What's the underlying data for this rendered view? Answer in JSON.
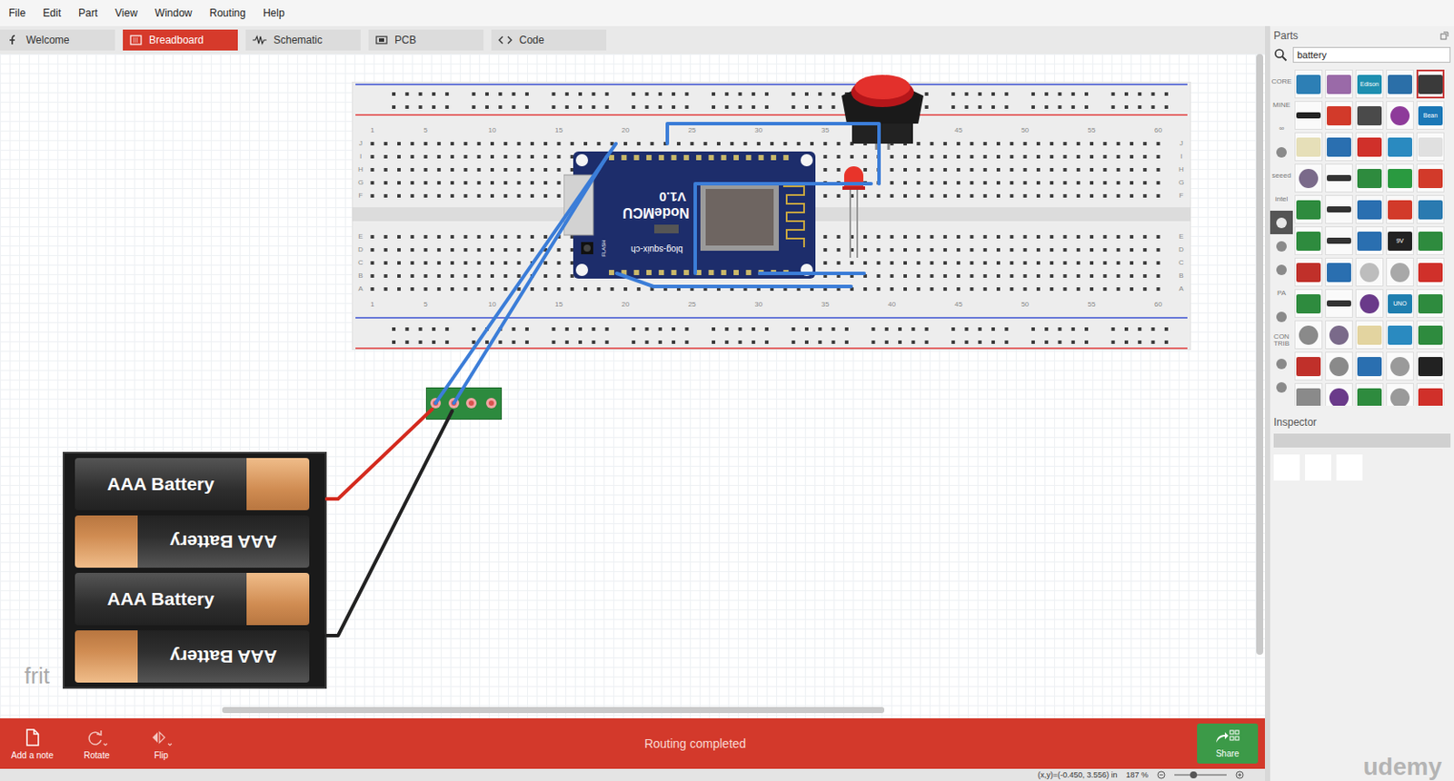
{
  "menu": [
    "File",
    "Edit",
    "Part",
    "View",
    "Window",
    "Routing",
    "Help"
  ],
  "tabs": [
    {
      "label": "Welcome",
      "selected": false
    },
    {
      "label": "Breadboard",
      "selected": true
    },
    {
      "label": "Schematic",
      "selected": false
    },
    {
      "label": "PCB",
      "selected": false
    },
    {
      "label": "Code",
      "selected": false
    }
  ],
  "canvas": {
    "watermark": "frit",
    "breadboard": {
      "columns": [
        "1",
        "5",
        "10",
        "15",
        "20",
        "25",
        "30",
        "35",
        "40",
        "45",
        "50",
        "55",
        "60"
      ],
      "rows_top": [
        "J",
        "I",
        "H",
        "G",
        "F"
      ],
      "rows_bottom": [
        "E",
        "D",
        "C",
        "B",
        "A"
      ]
    },
    "board": {
      "name": "NodeMCU",
      "version": "V1.0",
      "url": "blog-squix-ch",
      "button": "FLASH"
    },
    "batteries": [
      {
        "label": "AAA Battery",
        "flipped": false
      },
      {
        "label": "AAA Battery",
        "flipped": true
      },
      {
        "label": "AAA Battery",
        "flipped": false
      },
      {
        "label": "AAA Battery",
        "flipped": true
      }
    ],
    "wires": [
      {
        "color": "#3b7dd8"
      },
      {
        "color": "#3b7dd8"
      },
      {
        "color": "#3b7dd8"
      },
      {
        "color": "#3b7dd8"
      },
      {
        "color": "#3b7dd8"
      },
      {
        "color": "#3b7dd8"
      },
      {
        "color": "#d42a1e"
      },
      {
        "color": "#222222"
      }
    ]
  },
  "toolbar": {
    "buttons": [
      "Add a note",
      "Rotate",
      "Flip"
    ],
    "status": "Routing completed",
    "share": "Share"
  },
  "status_bar": {
    "coords": "(x,y)=(-0.450, 3.556) in",
    "zoom": "187 %"
  },
  "parts": {
    "title": "Parts",
    "search": "battery",
    "categories": [
      {
        "kind": "text",
        "label": "CORE",
        "selected": false
      },
      {
        "kind": "text",
        "label": "MINE",
        "selected": false
      },
      {
        "kind": "text",
        "label": "∞",
        "selected": false
      },
      {
        "kind": "icon",
        "selected": false
      },
      {
        "kind": "text",
        "label": "seeed",
        "selected": false
      },
      {
        "kind": "text",
        "label": "intel",
        "selected": false
      },
      {
        "kind": "icon",
        "selected": true
      },
      {
        "kind": "icon",
        "selected": false
      },
      {
        "kind": "icon",
        "selected": false
      },
      {
        "kind": "text",
        "label": "PA",
        "selected": false
      },
      {
        "kind": "icon",
        "selected": false
      },
      {
        "kind": "text",
        "label": "CON TRIB",
        "selected": false
      },
      {
        "kind": "icon",
        "selected": false
      },
      {
        "kind": "icon",
        "selected": false
      }
    ],
    "items": [
      {
        "kind": "board",
        "color": "#2d7fb5",
        "selected": false
      },
      {
        "kind": "board",
        "color": "#9a6aa8",
        "selected": false
      },
      {
        "kind": "board",
        "color": "#1e8fb0",
        "label": "Edison",
        "selected": false
      },
      {
        "kind": "board",
        "color": "#2b6fa8",
        "selected": false
      },
      {
        "kind": "board",
        "color": "#3a3a3a",
        "selected": true
      },
      {
        "kind": "bar",
        "color": "#222222",
        "selected": false
      },
      {
        "kind": "board",
        "color": "#d23a2a",
        "selected": false
      },
      {
        "kind": "board",
        "color": "#4a4a4a",
        "selected": false
      },
      {
        "kind": "round",
        "color": "#8e3b9a",
        "selected": false
      },
      {
        "kind": "board",
        "color": "#1b78b7",
        "label": "Bean",
        "selected": false
      },
      {
        "kind": "board",
        "color": "#e6dfb8",
        "selected": false
      },
      {
        "kind": "board",
        "color": "#2a6fb0",
        "selected": false
      },
      {
        "kind": "board",
        "color": "#d0302a",
        "selected": false
      },
      {
        "kind": "board",
        "color": "#2a8ac0",
        "selected": false
      },
      {
        "kind": "board",
        "color": "#e0e0e0",
        "selected": false
      },
      {
        "kind": "round",
        "color": "#7a6a8a",
        "selected": false
      },
      {
        "kind": "bar",
        "color": "#333333",
        "selected": false
      },
      {
        "kind": "board",
        "color": "#2e8b3e",
        "selected": false
      },
      {
        "kind": "board",
        "color": "#2a9a40",
        "selected": false
      },
      {
        "kind": "board",
        "color": "#d23a2a",
        "selected": false
      },
      {
        "kind": "board",
        "color": "#2e8b3e",
        "selected": false
      },
      {
        "kind": "bar",
        "color": "#333333",
        "selected": false
      },
      {
        "kind": "board",
        "color": "#2a6fb0",
        "selected": false
      },
      {
        "kind": "board",
        "color": "#d23a2a",
        "selected": false
      },
      {
        "kind": "board",
        "color": "#2a7ab0",
        "selected": false
      },
      {
        "kind": "board",
        "color": "#2e8b3e",
        "selected": false
      },
      {
        "kind": "bar",
        "color": "#333333",
        "selected": false
      },
      {
        "kind": "board",
        "color": "#2a6fb0",
        "selected": false
      },
      {
        "kind": "board",
        "color": "#222222",
        "label": "9V",
        "selected": false
      },
      {
        "kind": "board",
        "color": "#2e8b3e",
        "selected": false
      },
      {
        "kind": "board",
        "color": "#c0302a",
        "selected": false
      },
      {
        "kind": "board",
        "color": "#2a6fb0",
        "selected": false
      },
      {
        "kind": "round",
        "color": "#bdbdbd",
        "selected": false
      },
      {
        "kind": "round",
        "color": "#a8a8a8",
        "selected": false
      },
      {
        "kind": "board",
        "color": "#d0302a",
        "selected": false
      },
      {
        "kind": "board",
        "color": "#2e8b3e",
        "selected": false
      },
      {
        "kind": "bar",
        "color": "#333333",
        "selected": false
      },
      {
        "kind": "round",
        "color": "#6a3a8a",
        "selected": false
      },
      {
        "kind": "board",
        "color": "#1f7fb0",
        "label": "UNO",
        "selected": false
      },
      {
        "kind": "board",
        "color": "#2e8b3e",
        "selected": false
      },
      {
        "kind": "round",
        "color": "#8a8a8a",
        "selected": false
      },
      {
        "kind": "round",
        "color": "#7a6a8a",
        "selected": false
      },
      {
        "kind": "board",
        "color": "#e3d4a0",
        "selected": false
      },
      {
        "kind": "board",
        "color": "#2a8ac0",
        "selected": false
      },
      {
        "kind": "board",
        "color": "#2e8b3e",
        "selected": false
      },
      {
        "kind": "board",
        "color": "#c0302a",
        "selected": false
      },
      {
        "kind": "round",
        "color": "#8a8a8a",
        "selected": false
      },
      {
        "kind": "board",
        "color": "#2a6fb0",
        "selected": false
      },
      {
        "kind": "round",
        "color": "#9a9a9a",
        "selected": false
      },
      {
        "kind": "board",
        "color": "#222222",
        "selected": false
      },
      {
        "kind": "board",
        "color": "#8a8a8a",
        "selected": false
      },
      {
        "kind": "round",
        "color": "#6a3a8a",
        "selected": false
      },
      {
        "kind": "board",
        "color": "#2e8b3e",
        "selected": false
      },
      {
        "kind": "round",
        "color": "#9a9a9a",
        "selected": false
      },
      {
        "kind": "board",
        "color": "#d0302a",
        "selected": false
      }
    ]
  },
  "inspector": {
    "title": "Inspector"
  },
  "watermark": "udemy"
}
